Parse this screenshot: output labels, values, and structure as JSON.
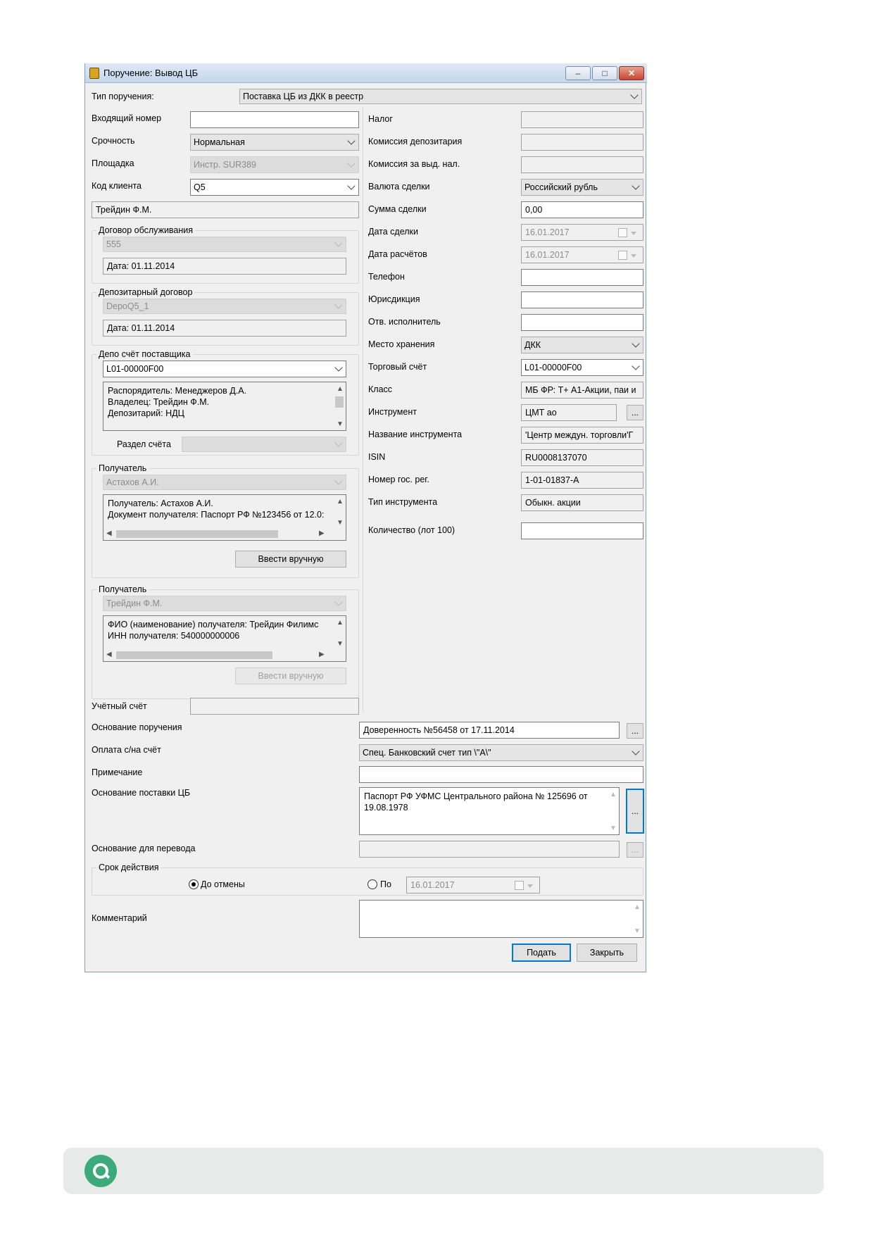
{
  "window": {
    "title": "Поручение: Вывод ЦБ"
  },
  "left": {
    "order_type_label": "Тип поручения:",
    "order_type_value": "Поставка ЦБ из ДКК в реестр",
    "incoming_number_label": "Входящий номер",
    "incoming_number_value": "",
    "urgency_label": "Срочность",
    "urgency_value": "Нормальная",
    "platform_label": "Площадка",
    "platform_value": "Инстр. SUR389",
    "client_code_label": "Код клиента",
    "client_code_value": "Q5",
    "client_name": "Трейдин Ф.М.",
    "service_contract": {
      "title": "Договор обслуживания",
      "value": "555",
      "date": "Дата: 01.11.2014"
    },
    "depo_contract": {
      "title": "Депозитарный договор",
      "value": "DepoQ5_1",
      "date": "Дата: 01.11.2014"
    },
    "supplier_account": {
      "title": "Депо счёт поставщика",
      "value": "L01-00000F00",
      "memo": [
        "Распорядитель: Менеджеров Д.А.",
        "Владелец: Трейдин Ф.М.",
        "Депозитарий: НДЦ"
      ],
      "section_label": "Раздел счёта",
      "section_value": ""
    },
    "recipient1": {
      "title": "Получатель",
      "value": "Астахов А.И.",
      "memo": [
        "Получатель: Астахов А.И.",
        "Документ получателя: Паспорт РФ №123456 от 12.0:"
      ],
      "button": "Ввести вручную"
    },
    "recipient2": {
      "title": "Получатель",
      "value": "Трейдин Ф.М.",
      "memo": [
        "ФИО (наименование) получателя: Трейдин Филимс",
        "ИНН получателя: 540000000006"
      ],
      "button": "Ввести вручную"
    },
    "accounting_label": "Учётный счёт",
    "accounting_value": ""
  },
  "right": {
    "tax_label": "Налог",
    "tax_value": "",
    "depo_fee_label": "Комиссия депозитария",
    "depo_fee_value": "",
    "cash_fee_label": "Комиссия за выд. нал.",
    "cash_fee_value": "",
    "currency_label": "Валюта сделки",
    "currency_value": "Российский рубль",
    "amount_label": "Сумма сделки",
    "amount_value": "0,00",
    "deal_date_label": "Дата сделки",
    "deal_date_value": "16.01.2017",
    "settle_date_label": "Дата расчётов",
    "settle_date_value": "16.01.2017",
    "phone_label": "Телефон",
    "phone_value": "",
    "jurisdiction_label": "Юрисдикция",
    "jurisdiction_value": "",
    "executor_label": "Отв. исполнитель",
    "executor_value": "",
    "storage_label": "Место хранения",
    "storage_value": "ДКК",
    "trade_account_label": "Торговый счёт",
    "trade_account_value": "L01-00000F00",
    "class_label": "Класс",
    "class_value": "МБ ФР: Т+ А1-Акции, паи и",
    "instrument_label": "Инструмент",
    "instrument_value": "ЦМТ ао",
    "instrument_name_label": "Название инструмента",
    "instrument_name_value": "'Центр междун. торговли'Г",
    "isin_label": "ISIN",
    "isin_value": "RU0008137070",
    "reg_number_label": "Номер гос. рег.",
    "reg_number_value": "1-01-01837-A",
    "instrument_type_label": "Тип инструмента",
    "instrument_type_value": "Обыкн. акции",
    "quantity_label": "Количество (лот 100)",
    "quantity_value": ""
  },
  "bottom": {
    "basis_label": "Основание поручения",
    "basis_value": "Доверенность №56458  от 17.11.2014",
    "payment_label": "Оплата с/на счёт",
    "payment_value": "Спец. Банковский счет тип \\\"А\\\"",
    "note_label": "Примечание",
    "note_value": "",
    "delivery_basis_label": "Основание поставки ЦБ",
    "delivery_basis_value": [
      "Паспорт РФ УФМС Центрального района № 125696 от",
      "19.08.1978"
    ],
    "transfer_basis_label": "Основание для перевода",
    "transfer_basis_value": "",
    "validity_title": "Срок действия",
    "until_cancel_label": "До отмены",
    "by_label": "По",
    "by_date": "16.01.2017",
    "comment_label": "Комментарий",
    "comment_value": "",
    "submit_label": "Подать",
    "close_label": "Закрыть",
    "ellipsis": "..."
  }
}
